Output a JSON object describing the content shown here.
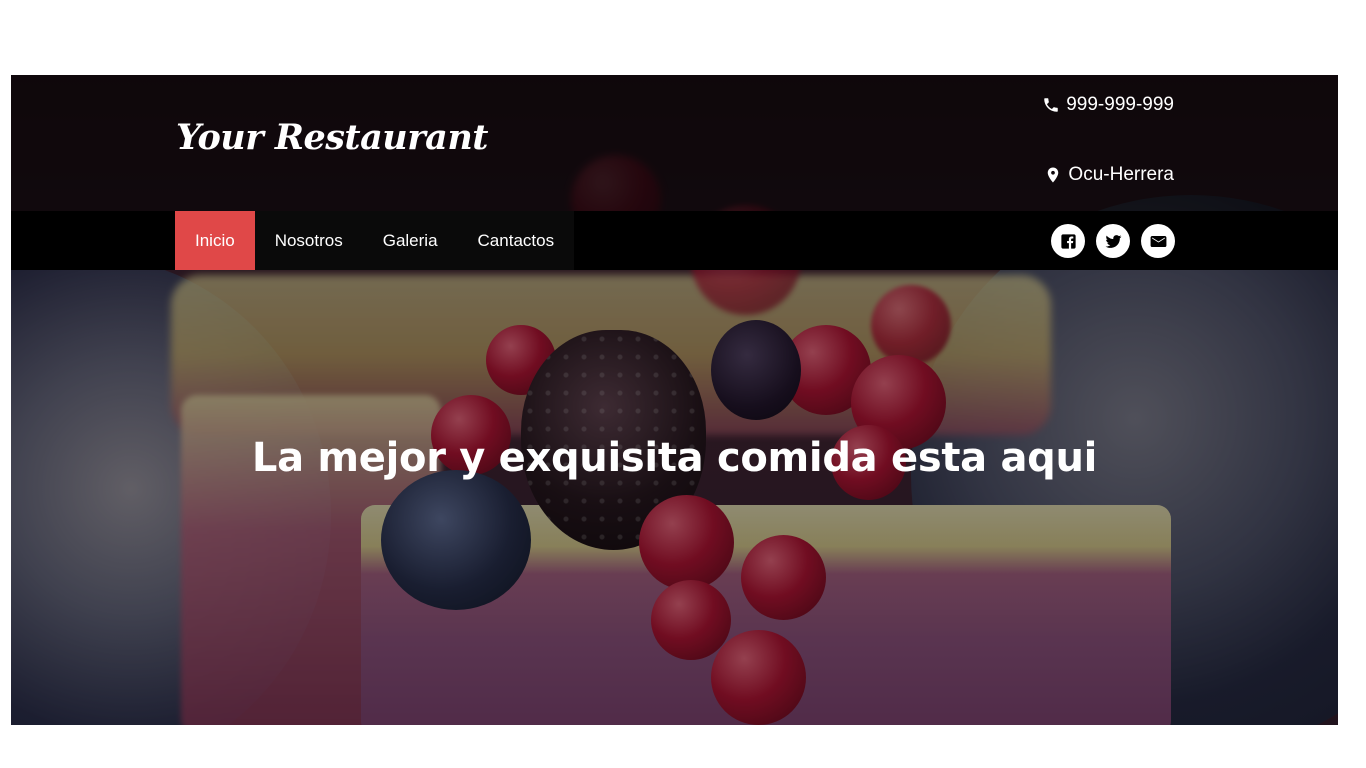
{
  "header": {
    "logo": "Your Restaurant",
    "phone": "999-999-999",
    "location": "Ocu-Herrera",
    "phone_icon": "phone-icon",
    "location_icon": "map-marker-icon"
  },
  "nav": {
    "items": [
      {
        "label": "Inicio",
        "active": true
      },
      {
        "label": "Nosotros"
      },
      {
        "label": "Galeria"
      },
      {
        "label": "Cantactos"
      }
    ],
    "active_color": "#e04848"
  },
  "social": {
    "icons": [
      "facebook-icon",
      "twitter-icon",
      "envelope-icon"
    ]
  },
  "hero": {
    "title": "La mejor y exquisita comida esta aqui"
  }
}
